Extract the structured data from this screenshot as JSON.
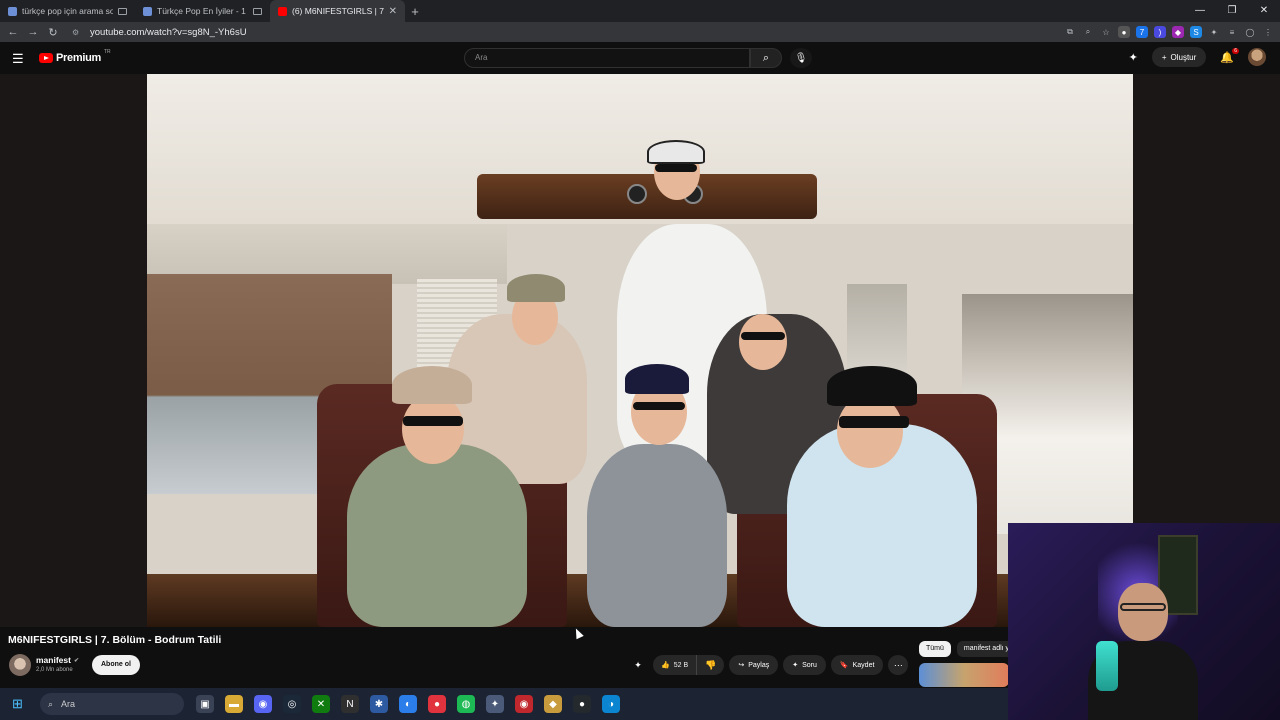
{
  "browser": {
    "tabs": [
      {
        "title": "türkçe pop için arama son",
        "active": false,
        "favicon_color": "#8ab4f8"
      },
      {
        "title": "Türkçe Pop En İyiler - 1 -",
        "active": false,
        "favicon_color": "#8ab4f8"
      },
      {
        "title": "(6) M6NIFESTGIRLS | 7. Bö",
        "active": true,
        "favicon_color": "#ff0000"
      }
    ],
    "new_tab": "+",
    "url": "youtube.com/watch?v=sg8N_-Yh6sU",
    "window_controls": [
      "—",
      "❐",
      "✕"
    ]
  },
  "youtube": {
    "logo_text": "Premium",
    "logo_region": "TR",
    "search_placeholder": "Ara",
    "create_label": "Oluştur",
    "notification_count": "6"
  },
  "video": {
    "title": "M6NIFESTGIRLS | 7. Bölüm - Bodrum Tatili",
    "channel": "manifest",
    "subscribers": "2,0 Mn abone",
    "subscribe_label": "Abone ol",
    "likes": "52 B",
    "share_label": "Paylaş",
    "ask_label": "Soru",
    "save_label": "Kaydet"
  },
  "chips": [
    "Tümü",
    "manifest adlı y"
  ],
  "taskbar": {
    "search_label": "Ara",
    "icons": [
      {
        "name": "task-view-icon",
        "glyph": "▣",
        "color": "#3a4256"
      },
      {
        "name": "file-explorer-icon",
        "glyph": "▬",
        "color": "#d8a934"
      },
      {
        "name": "discord-icon",
        "glyph": "◉",
        "color": "#5865f2"
      },
      {
        "name": "steam-icon",
        "glyph": "◎",
        "color": "#1b2838"
      },
      {
        "name": "xbox-icon",
        "glyph": "✕",
        "color": "#107c10"
      },
      {
        "name": "notion-icon",
        "glyph": "N",
        "color": "#2f2f2f"
      },
      {
        "name": "app-icon",
        "glyph": "✱",
        "color": "#2d5aa0"
      },
      {
        "name": "app-icon-2",
        "glyph": "◐",
        "color": "#2b7de9"
      },
      {
        "name": "record-icon",
        "glyph": "●",
        "color": "#e0333d"
      },
      {
        "name": "spotify-icon",
        "glyph": "◍",
        "color": "#1db954"
      },
      {
        "name": "network-icon",
        "glyph": "✦",
        "color": "#4a5a78"
      },
      {
        "name": "obs-icon",
        "glyph": "◉",
        "color": "#c0282d"
      },
      {
        "name": "game-icon",
        "glyph": "◆",
        "color": "#c89b3c"
      },
      {
        "name": "github-icon",
        "glyph": "●",
        "color": "#24292e"
      },
      {
        "name": "edge-icon",
        "glyph": "◑",
        "color": "#0c85d0"
      }
    ]
  }
}
